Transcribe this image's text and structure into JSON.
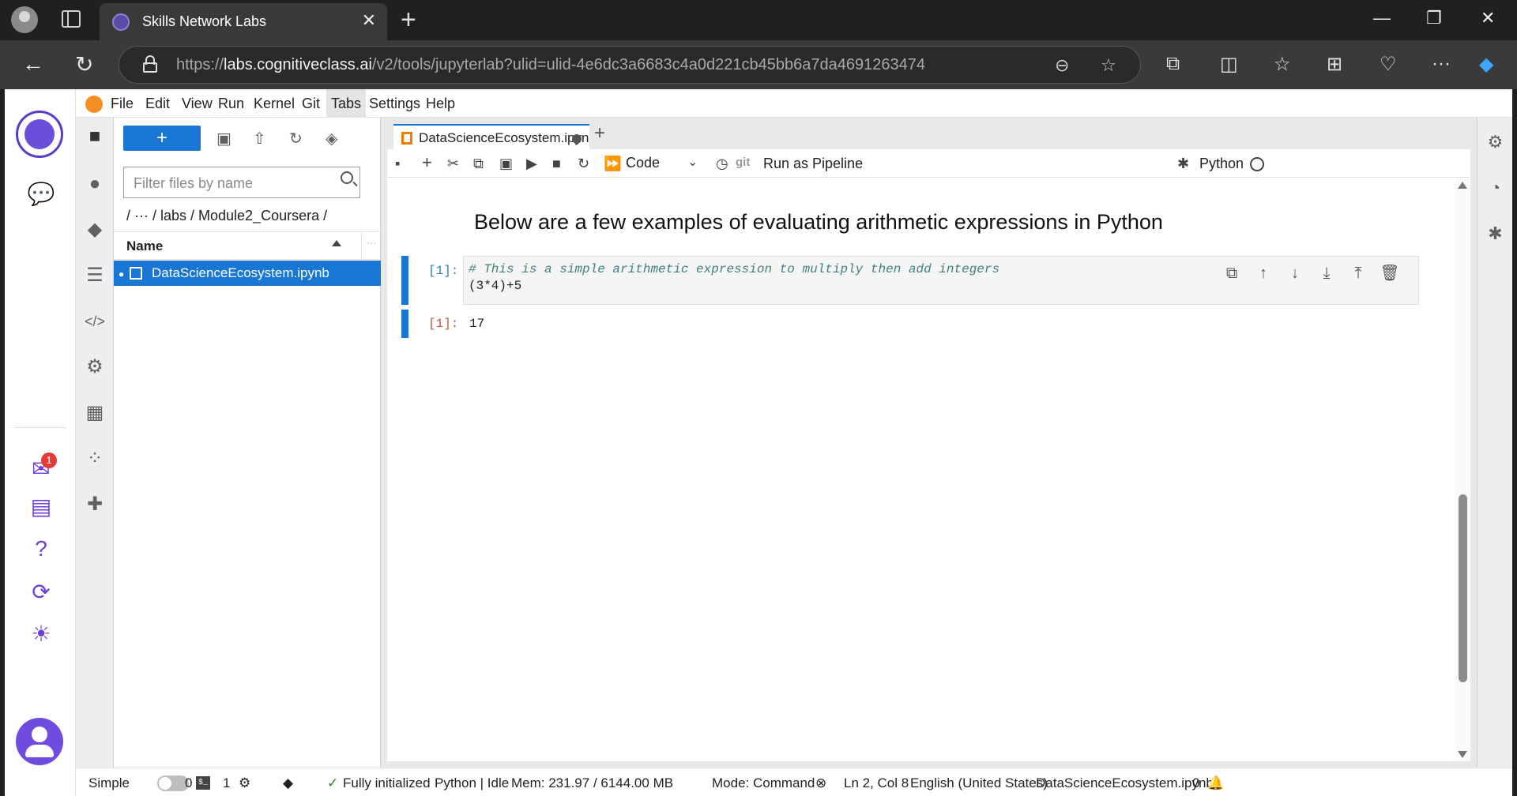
{
  "browser": {
    "tab_title": "Skills Network Labs",
    "url_prefix": "https://",
    "url_domain": "labs.cognitiveclass.ai",
    "url_path": "/v2/tools/jupyterlab?ulid=ulid-4e6dc3a6683c4a0d221cb45bb6a7da4691263474"
  },
  "menubar": {
    "items": [
      "File",
      "Edit",
      "View",
      "Run",
      "Kernel",
      "Git",
      "Tabs",
      "Settings",
      "Help"
    ],
    "active": "Tabs"
  },
  "left_rail": {
    "notification_count": "1"
  },
  "filebrowser": {
    "new_label": "+",
    "filter_placeholder": "Filter files by name",
    "breadcrumb": "/   ···   / labs / Module2_Coursera /",
    "column_name": "Name",
    "column_more": "···",
    "files": [
      {
        "name": "DataScienceEcosystem.ipynb",
        "selected": true,
        "running": true
      }
    ]
  },
  "notebook": {
    "tab_label": "DataScienceEcosystem.ipyn",
    "cell_type": "Code",
    "git_label": "git",
    "pipeline_label": "Run as Pipeline",
    "kernel_name": "Python",
    "markdown_heading": "Below are a few examples of evaluating arithmetic expressions in Python",
    "cells": [
      {
        "prompt": "[1]:",
        "code_comment": "# This is a simple arithmetic expression to multiply then add integers",
        "code_line": "(3*4)+5",
        "output_prompt": "[1]:",
        "output": "17"
      }
    ]
  },
  "statusbar": {
    "mode_label": "Simple",
    "terminals": "0",
    "kernels": "1",
    "init_status": "Fully initialized",
    "kernel_status": "Python | Idle",
    "memory": "Mem: 231.97 / 6144.00 MB",
    "mode": "Mode: Command",
    "cursor": "Ln 2, Col 8",
    "language": "English (United States)",
    "filename": "DataScienceEcosystem.ipynb",
    "notifications": "0"
  },
  "colors": {
    "accent": "#1976d2",
    "brand": "#6b3fd9"
  }
}
